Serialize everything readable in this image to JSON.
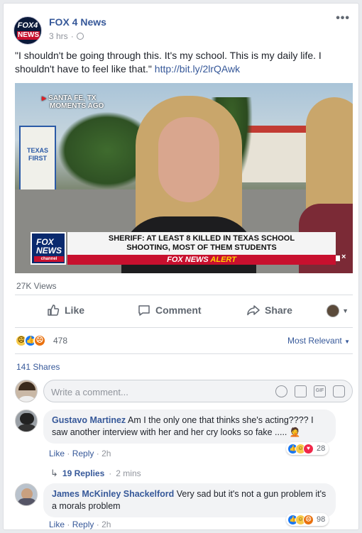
{
  "post": {
    "page_name": "FOX 4 News",
    "time": "3 hrs",
    "dot": "·",
    "logo_top": "FOX4",
    "logo_bottom": "NEWS",
    "text": "\"I shouldn't be going through this. It's my school. This is my daily life. I shouldn't have to feel like that.\"",
    "link": "http://bit.ly/2lrQAwk",
    "more_icon": "•••"
  },
  "video": {
    "location_line1": "SANTA FE, TX",
    "location_line2": "MOMENTS AGO",
    "sign_text": "TEXAS FIRST",
    "logo_line1": "FOX",
    "logo_line2": "NEWS",
    "logo_channel": "channel",
    "headline_line1": "SHERIFF: AT LEAST 8 KILLED IN TEXAS SCHOOL",
    "headline_line2": "SHOOTING, MOST OF THEM STUDENTS",
    "alert_prefix": "FOX NEWS",
    "alert_word": "ALERT"
  },
  "stats": {
    "views": "27K Views",
    "reaction_count": "478",
    "sort_label": "Most Relevant",
    "shares": "141 Shares"
  },
  "actions": {
    "like": "Like",
    "comment": "Comment",
    "share": "Share"
  },
  "composer": {
    "placeholder": "Write a comment...",
    "gif": "GIF"
  },
  "comments": [
    {
      "name": "Gustavo Martinez",
      "text": "Am I the only one that thinks she's acting???? I saw another interview with her and her cry looks so fake ..... 🤦",
      "like": "Like",
      "reply": "Reply",
      "time": "2h",
      "reaction_count": "28"
    },
    {
      "name": "James McKinley Shackelford",
      "text": "Very sad but it's not a gun problem it's a morals problem",
      "like": "Like",
      "reply": "Reply",
      "time": "2h",
      "reaction_count": "98"
    }
  ],
  "replies": {
    "label": "19 Replies",
    "time": "2 mins"
  },
  "colors": {
    "link": "#365899",
    "muted": "#90949c",
    "fox_red": "#c8102e",
    "fox_blue": "#0a2a6e"
  }
}
